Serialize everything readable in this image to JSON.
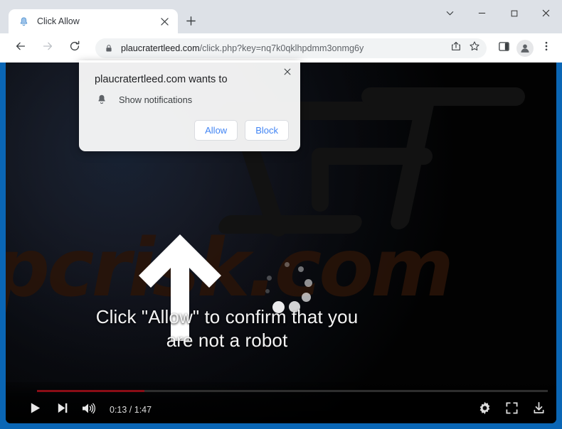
{
  "browser": {
    "tab": {
      "title": "Click Allow",
      "favicon_icon": "bell-favicon",
      "close_icon": "close-icon"
    },
    "new_tab_icon": "plus-icon",
    "window_controls": [
      {
        "name": "tab-search",
        "icon": "chevron-down-icon"
      },
      {
        "name": "minimize",
        "icon": "minimize-icon"
      },
      {
        "name": "maximize",
        "icon": "maximize-icon"
      },
      {
        "name": "close",
        "icon": "close-icon"
      }
    ],
    "nav": {
      "back_icon": "back-arrow-icon",
      "forward_icon": "forward-arrow-icon",
      "reload_icon": "reload-icon"
    },
    "omnibox": {
      "lock_icon": "lock-icon",
      "url_domain": "plaucratertleed.com",
      "url_path": "/click.php?key=nq7k0qklhpdmm3onmg6y",
      "full_url": "plaucratertleed.com/click.php?key=nq7k0qklhpdmm3onmg6y",
      "share_icon": "share-icon",
      "bookmark_icon": "star-icon"
    },
    "toolbar_icons": [
      {
        "name": "side-panel",
        "icon": "side-panel-icon"
      },
      {
        "name": "profile",
        "icon": "avatar-icon"
      },
      {
        "name": "chrome-menu",
        "icon": "three-dots-icon"
      }
    ]
  },
  "permission_dialog": {
    "title": "plaucratertleed.com wants to",
    "request_icon": "bell-icon",
    "request_label": "Show notifications",
    "allow_label": "Allow",
    "block_label": "Block",
    "close_icon": "close-icon"
  },
  "page": {
    "watermark": "pcrisk.com",
    "arrow_icon": "up-arrow-icon",
    "spinner_icon": "loading-spinner-icon",
    "message_line1": "Click \"Allow\" to confirm that you",
    "message_line2": "are not a robot"
  },
  "video_controls": {
    "play_icon": "play-icon",
    "next_icon": "next-track-icon",
    "volume_icon": "volume-icon",
    "time_display": "0:13 / 1:47",
    "settings_icon": "gear-icon",
    "fullscreen_icon": "fullscreen-icon",
    "download_icon": "download-icon",
    "progress_percent": 21,
    "progress_color": "#8b0d16"
  },
  "colors": {
    "window_frame": "#0a66b5",
    "tabstrip": "#dde1e7",
    "toolbar": "#ffffff",
    "omnibox": "#f1f3f4",
    "link_blue": "#4285f4",
    "video_bg": "#000000"
  }
}
